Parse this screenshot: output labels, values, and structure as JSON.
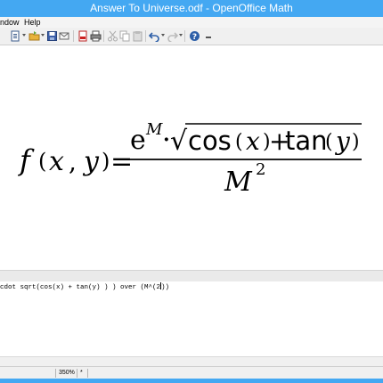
{
  "window": {
    "title": "Answer To Universe.odf - OpenOffice Math"
  },
  "menu": {
    "items": [
      "ndow",
      "Help"
    ]
  },
  "formula": {
    "lhs_f": "f",
    "lp": "(",
    "x": "x",
    "comma": ",",
    "y": "y",
    "rp": ")",
    "eq": "=",
    "e": "e",
    "M_sup": "M",
    "dot": "·",
    "sqrt": "√",
    "cos": "cos",
    "cos_lp": "(",
    "cos_x": "x",
    "cos_rp": ")",
    "plus": "+",
    "tan": "tan",
    "tan_lp": "(",
    "tan_y": "y",
    "tan_rp": ")",
    "den_M": "M",
    "den_exp": "2"
  },
  "command": {
    "text": "cdot sqrt(cos(x) + tan(y) ) ) over (M^(2",
    "after_caret": "))"
  },
  "status": {
    "zoom": "350%",
    "modified": "*"
  },
  "colors": {
    "titlebar": "#44a8f2"
  },
  "toolbar": {
    "icons": [
      "new-icon",
      "open-icon",
      "save-icon",
      "mail-icon",
      "export-pdf-icon",
      "print-icon",
      "cut-icon",
      "copy-icon",
      "paste-icon",
      "undo-icon",
      "redo-icon",
      "help-icon"
    ]
  }
}
